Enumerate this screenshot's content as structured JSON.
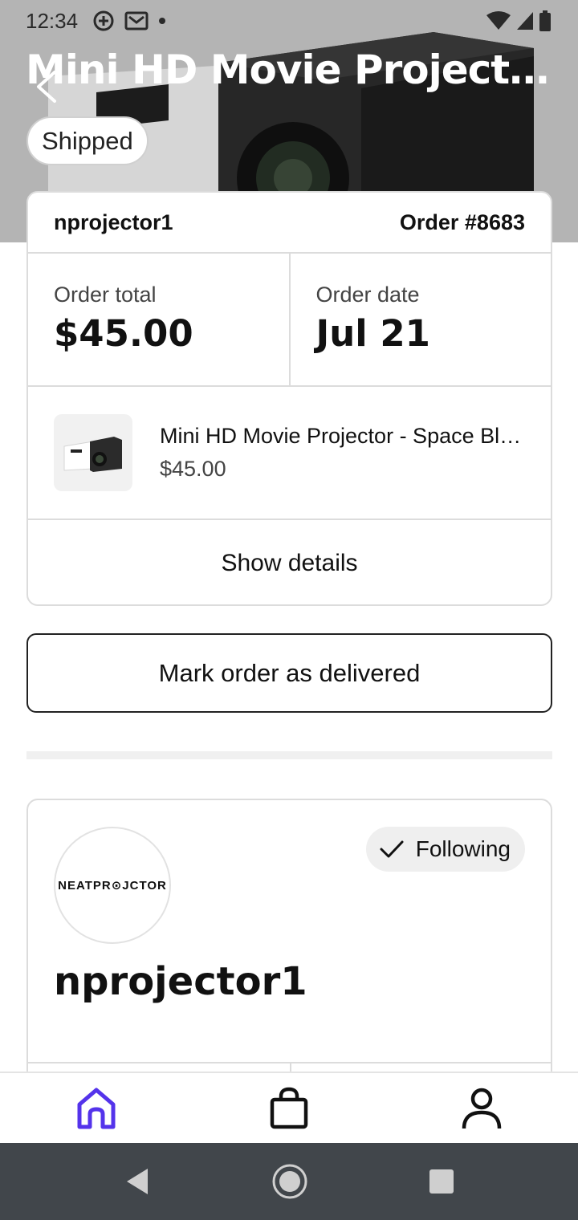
{
  "status_bar": {
    "time": "12:34",
    "icons_left": [
      "add-circle-icon",
      "gmail-icon",
      "dot-icon"
    ],
    "icons_right": [
      "wifi-icon",
      "signal-icon",
      "battery-icon"
    ]
  },
  "hero": {
    "title": "Mini HD Movie Projector - Space Black",
    "status_badge": "Shipped"
  },
  "order": {
    "shop_name": "nprojector1",
    "order_number": "Order #8683",
    "total_label": "Order total",
    "total_value": "$45.00",
    "date_label": "Order date",
    "date_value": "Jul 21",
    "item": {
      "name": "Mini HD Movie Projector - Space Black",
      "price": "$45.00"
    },
    "show_details_label": "Show details"
  },
  "actions": {
    "mark_delivered_label": "Mark order as delivered"
  },
  "shop": {
    "logo_text": "NEATPR⊙JCTOR",
    "follow_label": "Following",
    "name": "nprojector1"
  },
  "bottom_nav": {
    "items": [
      {
        "name": "home",
        "active": true
      },
      {
        "name": "shop"
      },
      {
        "name": "profile"
      }
    ],
    "active_color": "#5433EB"
  }
}
